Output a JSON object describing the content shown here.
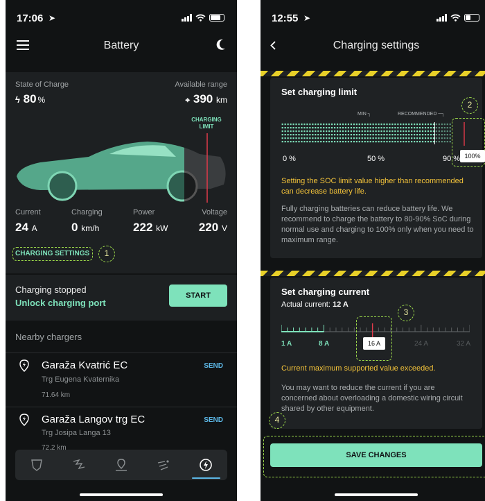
{
  "left": {
    "status": {
      "time": "17:06"
    },
    "nav": {
      "title": "Battery"
    },
    "soc": {
      "label": "State of Charge",
      "value": "80",
      "unit": "%"
    },
    "range": {
      "label": "Available range",
      "value": "390",
      "unit": "km"
    },
    "charging_limit_label": "CHARGING LIMIT",
    "stats": [
      {
        "label": "Current",
        "value": "24",
        "unit": "A"
      },
      {
        "label": "Charging",
        "value": "0",
        "unit": "km/h"
      },
      {
        "label": "Power",
        "value": "222",
        "unit": "kW"
      },
      {
        "label": "Voltage",
        "value": "220",
        "unit": "V"
      }
    ],
    "settings_link": "CHARGING SETTINGS",
    "callout_1": "1",
    "charging_status": {
      "title": "Charging stopped",
      "link": "Unlock charging port",
      "button": "START"
    },
    "nearby_title": "Nearby chargers",
    "chargers": [
      {
        "name": "Garaža Kvatrić EC",
        "address": "Trg Eugena Kvaternika",
        "distance": "71.64 km",
        "action": "SEND"
      },
      {
        "name": "Garaža Langov trg EC",
        "address": "Trg Josipa Langa 13",
        "distance": "72.2 km",
        "action": "SEND"
      }
    ],
    "tabs": [
      "car-icon",
      "route-icon",
      "location-icon",
      "wind-icon",
      "charging-icon"
    ]
  },
  "right": {
    "status": {
      "time": "12:55"
    },
    "nav": {
      "title": "Charging settings"
    },
    "limit": {
      "title": "Set charging limit",
      "min_label": "MIN",
      "recommended_label": "RECOMMENDED",
      "ticks": [
        "0 %",
        "50 %",
        "90 %"
      ],
      "value_badge": "100%",
      "value_percent": 100,
      "callout": "2",
      "warning": "Setting the SOC limit value higher than recommended can decrease battery life.",
      "info": "Fully charging batteries can reduce battery life. We recommend to charge the battery to 80-90% SoC during normal use and charging to 100% only when you need to maximum range."
    },
    "current": {
      "title": "Set charging current",
      "actual_label": "Actual current:",
      "actual_value": "12 A",
      "ticks": [
        "1 A",
        "8 A",
        "24 A",
        "32 A"
      ],
      "value_badge": "16 A",
      "value_amps": 16,
      "callout": "3",
      "warning": "Current maximum supported value exceeded.",
      "info": "You may want to reduce the current if you are concerned about overloading a domestic wiring circuit shared by other equipment."
    },
    "callout_4": "4",
    "save_button": "SAVE CHANGES"
  },
  "colors": {
    "accent": "#7ee2bb",
    "warning": "#f2c23a",
    "link": "#5cb7e6",
    "callout": "#9bd84a",
    "background": "#111314",
    "card": "#1f2224"
  }
}
